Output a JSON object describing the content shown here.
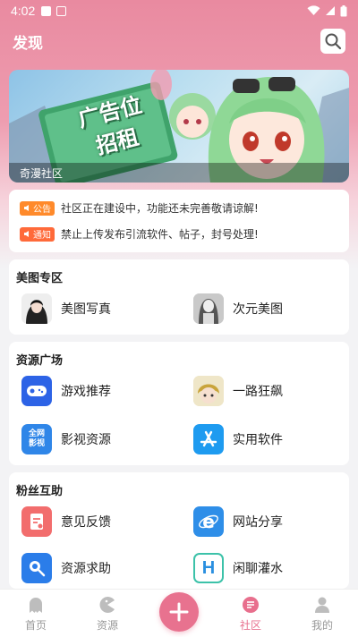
{
  "status_bar": {
    "time": "4:02"
  },
  "header": {
    "title": "发现"
  },
  "banner": {
    "caption": "奇漫社区",
    "sign_line1": "广告位",
    "sign_line2": "招租"
  },
  "notices": [
    {
      "badge": "公告",
      "text": "社区正在建设中，功能还未完善敬请谅解!"
    },
    {
      "badge": "通知",
      "text": "禁止上传发布引流软件、帖子，封号处理!"
    }
  ],
  "sections": {
    "meitu": {
      "title": "美图专区",
      "items": [
        {
          "label": "美图写真",
          "icon": "portrait-photo-icon"
        },
        {
          "label": "次元美图",
          "icon": "anime-art-icon"
        }
      ]
    },
    "resources": {
      "title": "资源广场",
      "items": [
        {
          "label": "游戏推荐",
          "icon": "gamepad-icon"
        },
        {
          "label": "一路狂飙",
          "icon": "anime-avatar-icon"
        },
        {
          "label": "影视资源",
          "icon": "video-badge-icon",
          "icon_text_1": "全网",
          "icon_text_2": "影视"
        },
        {
          "label": "实用软件",
          "icon": "app-store-icon"
        }
      ]
    },
    "fans": {
      "title": "粉丝互助",
      "items": [
        {
          "label": "意见反馈",
          "icon": "feedback-icon"
        },
        {
          "label": "网站分享",
          "icon": "browser-e-icon"
        },
        {
          "label": "资源求助",
          "icon": "search-help-icon"
        },
        {
          "label": "闲聊灌水",
          "icon": "chat-h-icon"
        }
      ]
    }
  },
  "bottom_nav": [
    {
      "label": "首页",
      "icon": "ghost-icon"
    },
    {
      "label": "资源",
      "icon": "pacman-icon"
    },
    {
      "label": "",
      "icon": "plus-icon"
    },
    {
      "label": "社区",
      "icon": "community-icon",
      "active": true
    },
    {
      "label": "我的",
      "icon": "person-icon"
    }
  ],
  "colors": {
    "accent": "#e8728f",
    "header_pink": "#e98aa0",
    "notice_orange": "#ff8a2b"
  }
}
